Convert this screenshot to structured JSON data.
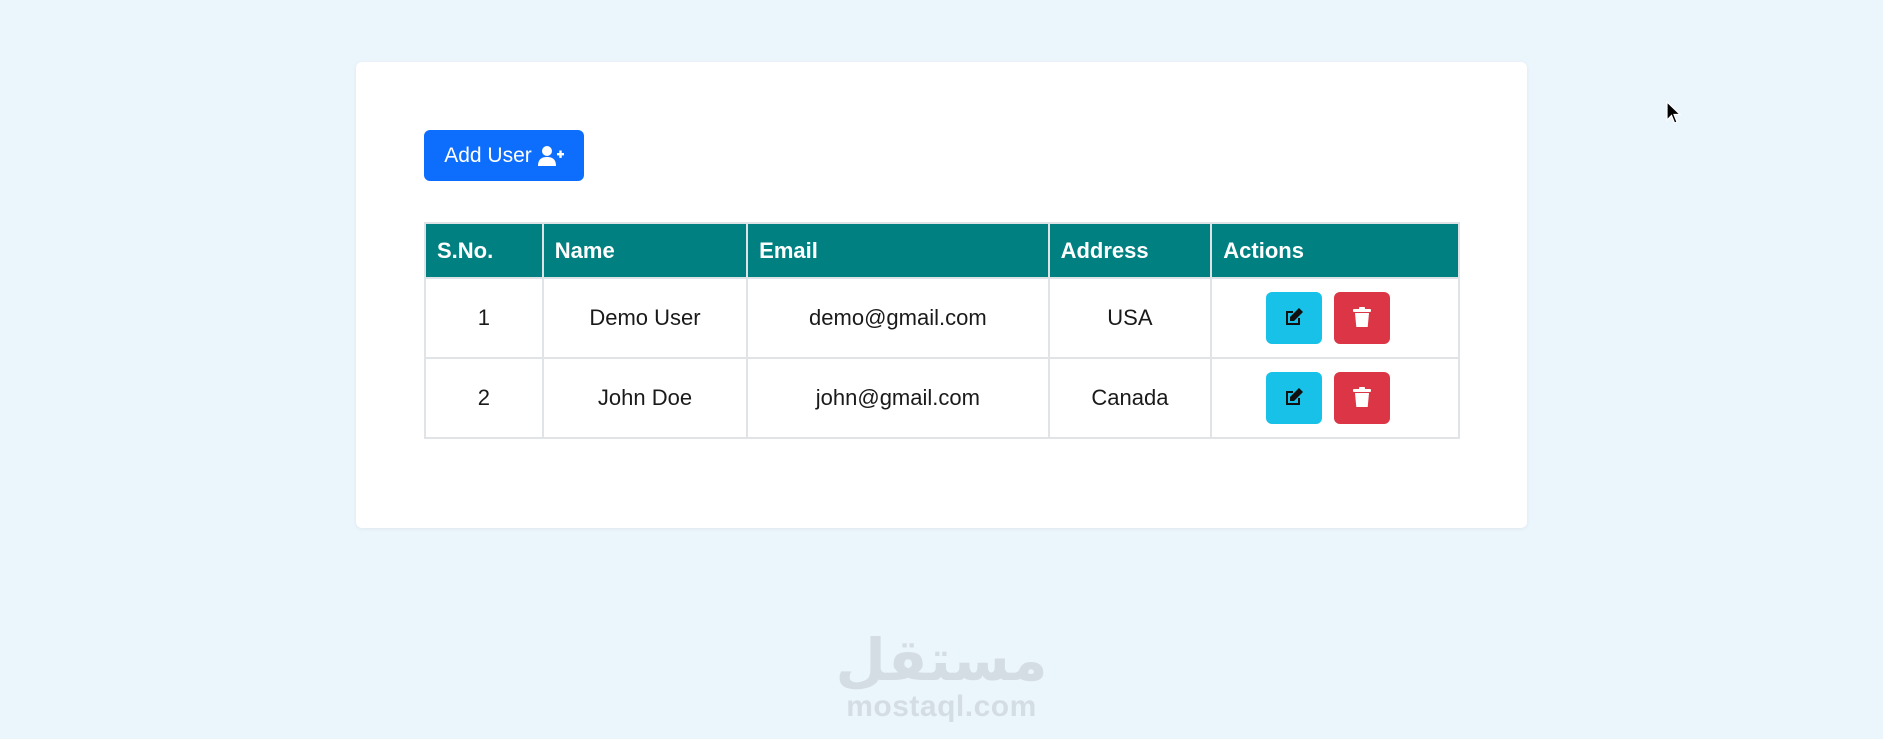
{
  "toolbar": {
    "add_user_label": "Add User",
    "add_user_icon": "user-plus-icon"
  },
  "table": {
    "columns": [
      "S.No.",
      "Name",
      "Email",
      "Address",
      "Actions"
    ],
    "rows": [
      {
        "sno": "1",
        "name": "Demo User",
        "email": "demo@gmail.com",
        "address": "USA"
      },
      {
        "sno": "2",
        "name": "John Doe",
        "email": "john@gmail.com",
        "address": "Canada"
      }
    ],
    "row_actions": {
      "edit_icon": "edit-icon",
      "delete_icon": "trash-icon"
    }
  },
  "watermark": {
    "arabic": "مستقل",
    "latin": "mostaql.com"
  },
  "colors": {
    "page_background": "#ebf5fc",
    "primary_button": "#0d6efd",
    "table_header": "#008080",
    "edit_button": "#17c1e8",
    "delete_button": "#dc3545"
  }
}
